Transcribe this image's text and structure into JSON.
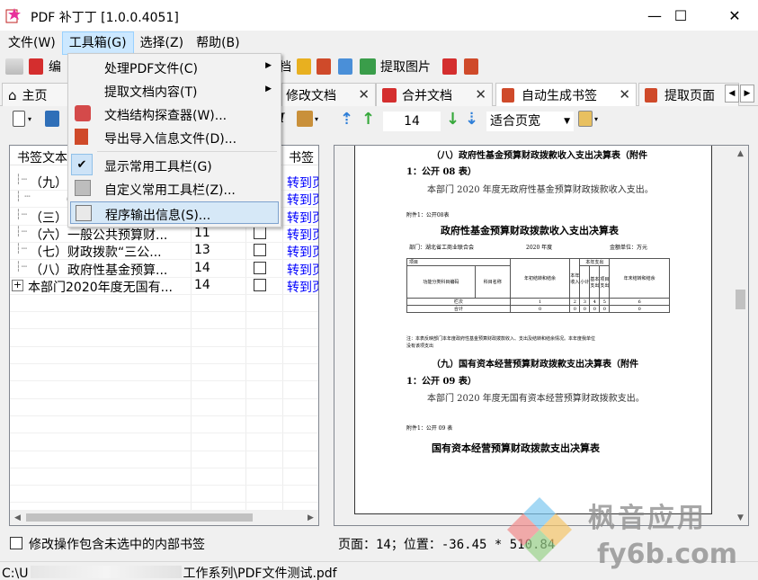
{
  "window": {
    "title": "PDF 补丁丁 [1.0.0.4051]",
    "minimize": "—",
    "maximize": "☐",
    "close": "✕"
  },
  "menubar": {
    "items": [
      "文件(W)",
      "工具箱(G)",
      "选择(Z)",
      "帮助(B)"
    ]
  },
  "toolbar": {
    "edit_label": "编",
    "doc_label": "档",
    "extract_images_label": "提取图片"
  },
  "tabs": {
    "items": [
      "主页",
      "修改文档",
      "合并文档",
      "自动生成书签",
      "提取页面"
    ],
    "close_glyph": "✕"
  },
  "toolbar2": {
    "page_number": "14",
    "zoom": "适合页宽"
  },
  "dropdown": {
    "items": [
      {
        "label": "处理PDF文件(C)",
        "has_submenu": true
      },
      {
        "label": "提取文档内容(T)",
        "has_submenu": true
      },
      {
        "label": "文档结构探查器(W)...",
        "has_submenu": false
      },
      {
        "label": "导出导入信息文件(D)...",
        "has_submenu": false
      },
      {
        "label": "显示常用工具栏(G)",
        "checked": true
      },
      {
        "label": "自定义常用工具栏(Z)...",
        "has_submenu": false
      },
      {
        "label": "程序输出信息(S)...",
        "highlighted": true
      }
    ]
  },
  "bookmarks": {
    "col_text": "书签文本",
    "col_action": "书签",
    "rows": [
      {
        "name": "（九）",
        "page": "",
        "link": "转到页"
      },
      {
        "name": "（",
        "page": "",
        "link": "转到页"
      },
      {
        "name": "（三）",
        "page": "",
        "link": "转到页"
      },
      {
        "name": "（六）一般公共预算财...",
        "page": "11",
        "link": "转到页"
      },
      {
        "name": "（七）财政拨款“三公...",
        "page": "13",
        "link": "转到页"
      },
      {
        "name": "（八）政府性基金预算...",
        "page": "14",
        "link": "转到页"
      },
      {
        "name": "本部门2020年度无国有...",
        "page": "14",
        "link": "转到页"
      }
    ]
  },
  "document": {
    "heading1a": "（八）政府性基金预算财政拨款收入支出决算表（附件",
    "heading1b": "1：公开 08 表）",
    "para1": "本部门 2020 年度无政府性基金预算财政拨款收入支出。",
    "attach1": "附件1：公开08表",
    "table_title1": "政府性基金预算财政拨款收入支出决算表",
    "dept": "部门：湖北省工商业联合会",
    "year": "2020 年度",
    "unit": "金额单位：万元",
    "table": {
      "project": "项目",
      "func_code": "功能分类科目编码",
      "subject_name": "科目名称",
      "begin_balance": "年初结转和结余",
      "this_year_income": "本年收入",
      "this_year_expense": "本年支出",
      "subtotal": "小计",
      "basic_expense": "基本支出",
      "project_expense": "项目支出",
      "end_balance": "年末结转和结余",
      "row_col": "栏次",
      "row_total": "合计",
      "col_nums": [
        "1",
        "2",
        "3",
        "4",
        "5",
        "6"
      ],
      "totals": [
        "0",
        "0",
        "0",
        "0",
        "0",
        "0"
      ]
    },
    "note": "注：本表反映部门本年度政府性基金预算财政拨款收入、支出及结转和结余情况。本年度我单位",
    "note2": "没有该项支出",
    "heading2a": "（九）国有资本经营预算财政拨款支出决算表（附件",
    "heading2b": "1：公开 09 表）",
    "para2": "本部门 2020 年度无国有资本经营预算财政拨款支出。",
    "attach2": "附件1：公开 09 表",
    "table_title2": "国有资本经营预算财政拨款支出决算表"
  },
  "footer": {
    "checkbox_label": "修改操作包含未选中的内部书签",
    "position": "页面：14；位置：-36.45 * 510.84",
    "path_prefix": "C:\\U",
    "path_suffix": "工作系列\\PDF文件测试.pdf"
  },
  "watermark": {
    "line1": "枫音应用",
    "line2": "fy6b.com"
  }
}
